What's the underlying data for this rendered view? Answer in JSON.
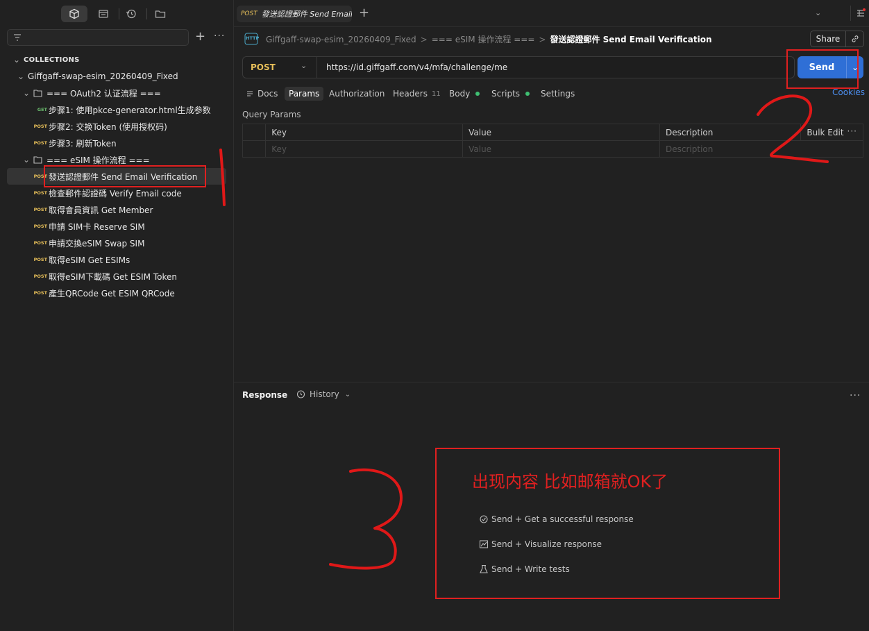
{
  "sidebar": {
    "filter_placeholder": "",
    "collections_header": "COLLECTIONS",
    "collection_name": "Giffgaff-swap-esim_20260409_Fixed",
    "folders": [
      {
        "label": "=== OAuth2 认证流程 ===",
        "items": [
          {
            "method": "GET",
            "label": "步骤1: 使用pkce-generator.html生成参数"
          },
          {
            "method": "POST",
            "label": "步骤2: 交换Token (使用授权码)"
          },
          {
            "method": "POST",
            "label": "步骤3: 刷新Token"
          }
        ]
      },
      {
        "label": "=== eSIM 操作流程 ===",
        "items": [
          {
            "method": "POST",
            "label": "發送認證郵件 Send Email Verification"
          },
          {
            "method": "POST",
            "label": "檢查郵件認證碼 Verify Email code"
          },
          {
            "method": "POST",
            "label": "取得會員資訊 Get Member"
          },
          {
            "method": "POST",
            "label": "申請 SIM卡 Reserve SIM"
          },
          {
            "method": "POST",
            "label": "申請交換eSIM Swap SIM"
          },
          {
            "method": "POST",
            "label": "取得eSIM Get ESIMs"
          },
          {
            "method": "POST",
            "label": "取得eSIM下載碼 Get ESIM Token"
          },
          {
            "method": "POST",
            "label": "產生QRCode Get ESIM QRCode"
          }
        ]
      }
    ]
  },
  "tab": {
    "method": "POST",
    "title": "發送認證郵件 Send Email"
  },
  "breadcrumb": {
    "http_badge": "HTTP",
    "collection": "Giffgaff-swap-esim_20260409_Fixed",
    "folder": "=== eSIM 操作流程 ===",
    "request": "發送認證郵件 Send Email Verification",
    "sep": ">"
  },
  "share_label": "Share",
  "request": {
    "method": "POST",
    "url": "https://id.giffgaff.com/v4/mfa/challenge/me",
    "send_label": "Send"
  },
  "request_tabs": {
    "docs": "Docs",
    "params": "Params",
    "authorization": "Authorization",
    "headers": "Headers",
    "headers_count": "11",
    "body": "Body",
    "scripts": "Scripts",
    "settings": "Settings",
    "cookies": "Cookies"
  },
  "query_params": {
    "title": "Query Params",
    "columns": [
      "Key",
      "Value",
      "Description"
    ],
    "bulk_edit": "Bulk Edit",
    "placeholders": [
      "Key",
      "Value",
      "Description"
    ]
  },
  "response": {
    "label": "Response",
    "history_label": "History",
    "hints": [
      "Send + Get a successful response",
      "Send + Visualize response",
      "Send + Write tests"
    ]
  },
  "annotation": {
    "text": "出现内容 比如邮箱就OK了"
  },
  "colors": {
    "accent": "#2f6fd6",
    "post": "#e8c05a",
    "get": "#6bbd6e",
    "annotation_red": "#e02020"
  }
}
